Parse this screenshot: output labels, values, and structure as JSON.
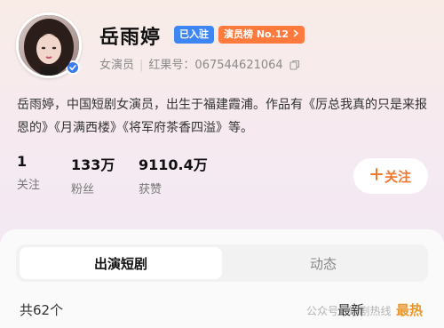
{
  "profile": {
    "name": "岳雨婷",
    "tag_settled": "已入驻",
    "tag_rank": "演员榜 No.12",
    "role": "女演员",
    "id_label": "红果号：",
    "id_value": "067544621064",
    "bio": "岳雨婷，中国短剧女演员，出生于福建霞浦。作品有《厉总我真的只是来报恩的》《月满西楼》《将军府茶香四溢》等。"
  },
  "stats": [
    {
      "value": "1",
      "label": "关注"
    },
    {
      "value": "133万",
      "label": "粉丝"
    },
    {
      "value": "9110.4万",
      "label": "获赞"
    }
  ],
  "follow_button": {
    "label": "关注"
  },
  "tabs": [
    {
      "label": "出演短剧",
      "active": true
    },
    {
      "label": "动态",
      "active": false
    }
  ],
  "list": {
    "total": "共62个",
    "sort_latest": "最新",
    "sort_hot": "最热"
  },
  "watermark": "公众号 · 短剧热线",
  "colors": {
    "settled_tag": "#3f86f5",
    "rank_tag": "#ff7a3c",
    "follow_text": "#f0782c",
    "hot_sort": "#e9962b"
  },
  "icons": [
    "verified-badge-icon",
    "chevron-right-icon",
    "copy-icon",
    "plus-icon"
  ]
}
